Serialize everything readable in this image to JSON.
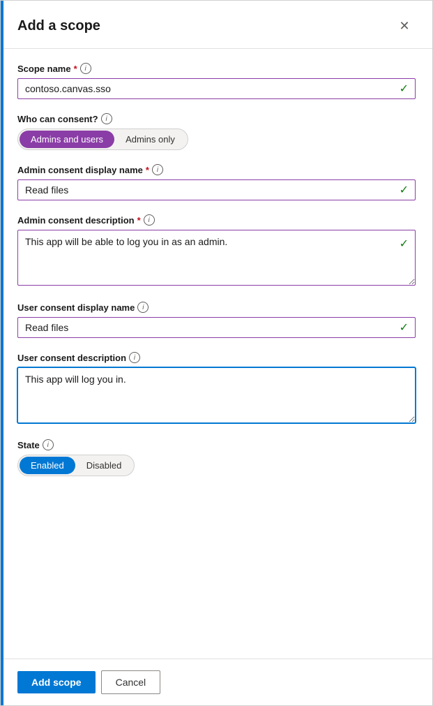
{
  "dialog": {
    "title": "Add a scope",
    "close_label": "✕"
  },
  "fields": {
    "scope_name": {
      "label": "Scope name",
      "required": true,
      "value": "contoso.canvas.sso",
      "check_icon": "✓"
    },
    "who_can_consent": {
      "label": "Who can consent?",
      "options": [
        "Admins and users",
        "Admins only"
      ],
      "selected": "Admins and users"
    },
    "admin_consent_display_name": {
      "label": "Admin consent display name",
      "required": true,
      "value": "Read files",
      "check_icon": "✓"
    },
    "admin_consent_description": {
      "label": "Admin consent description",
      "required": true,
      "value": "This app will be able to log you in as an admin.",
      "check_icon": "✓"
    },
    "user_consent_display_name": {
      "label": "User consent display name",
      "value": "Read files",
      "check_icon": "✓"
    },
    "user_consent_description": {
      "label": "User consent description",
      "value": "This app will log you in."
    },
    "state": {
      "label": "State",
      "options": [
        "Enabled",
        "Disabled"
      ],
      "selected": "Enabled"
    }
  },
  "footer": {
    "add_button": "Add scope",
    "cancel_button": "Cancel"
  },
  "icons": {
    "info": "i",
    "check": "✓",
    "close": "✕"
  }
}
